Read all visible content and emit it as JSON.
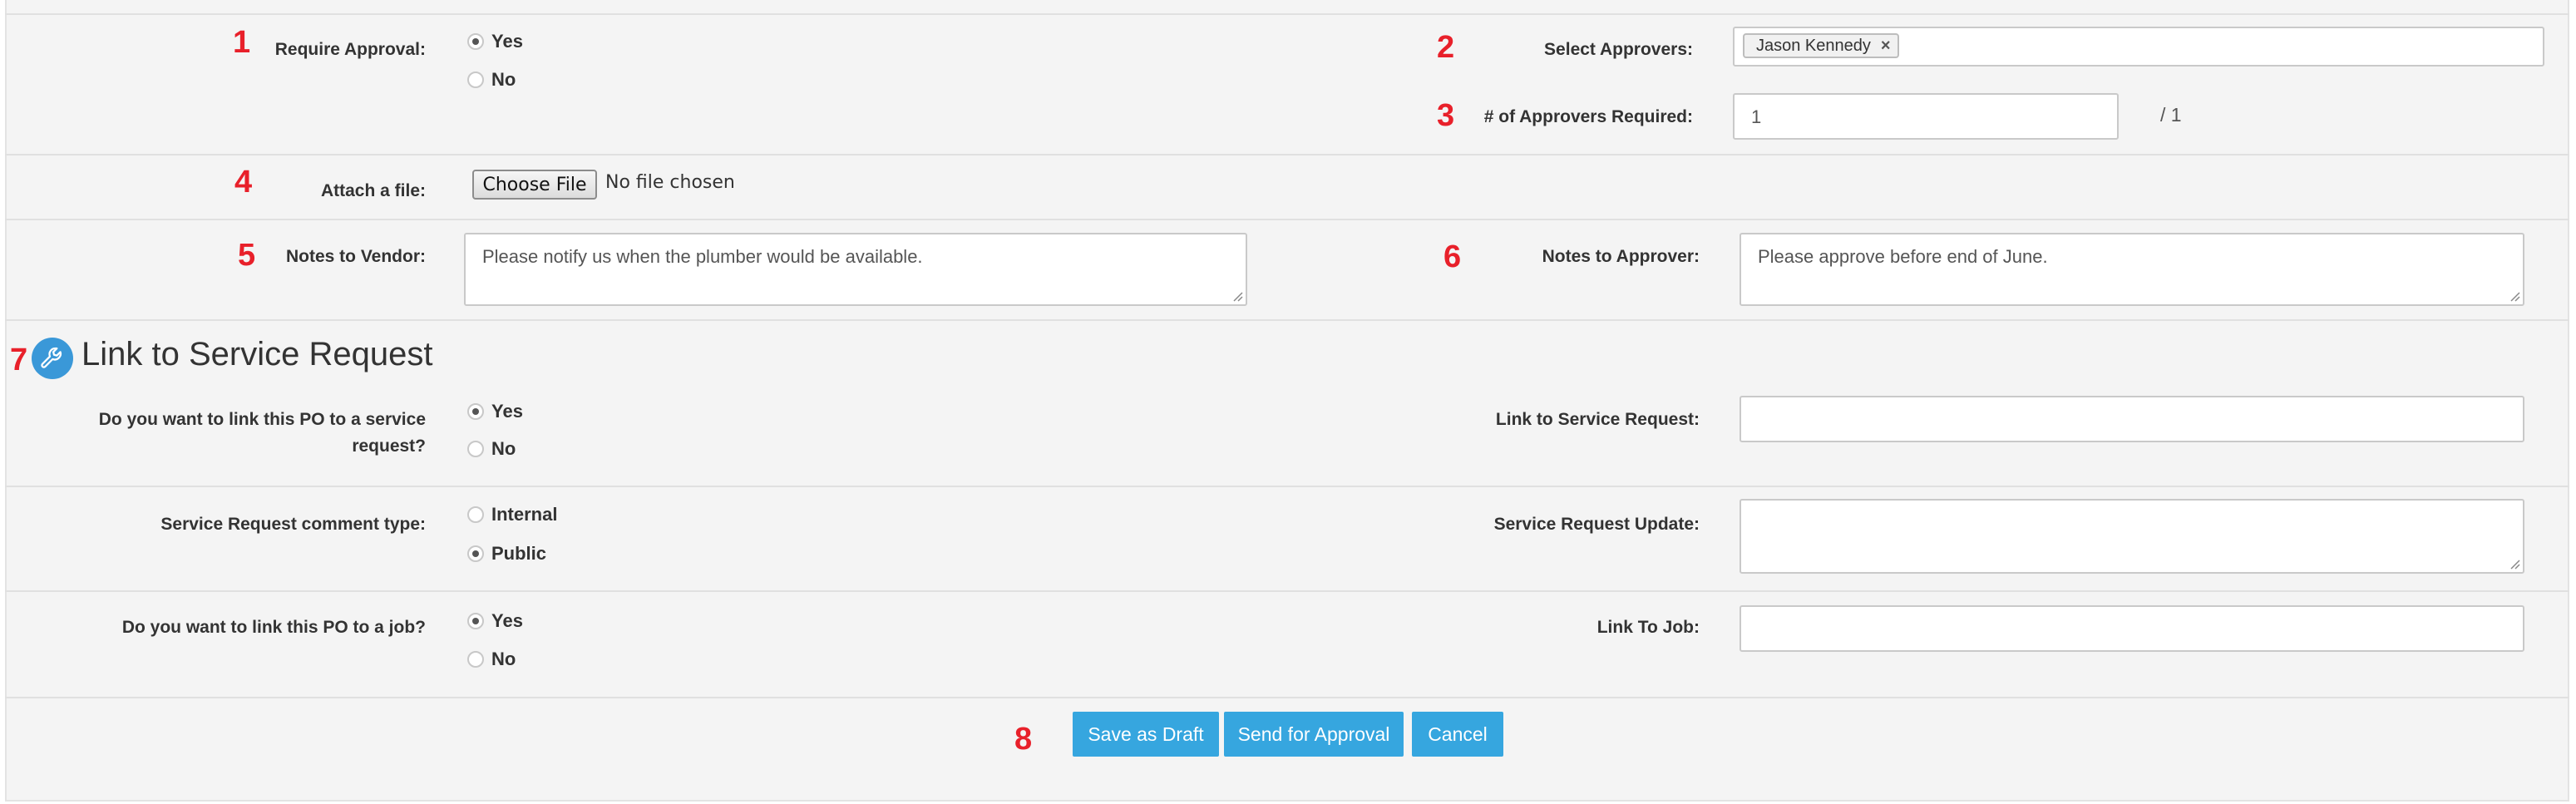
{
  "markers": [
    "1",
    "2",
    "3",
    "4",
    "5",
    "6",
    "7",
    "8"
  ],
  "approval": {
    "require_label": "Require Approval:",
    "yes": "Yes",
    "no": "No",
    "select_label": "Select Approvers:",
    "approver_tag": "Jason Kennedy",
    "remove_icon": "×",
    "required_label": "# of Approvers Required:",
    "required_value": "1",
    "required_suffix": "/ 1"
  },
  "attach": {
    "label": "Attach a file:",
    "button": "Choose File",
    "status": "No file chosen"
  },
  "notes": {
    "vendor_label": "Notes to Vendor:",
    "vendor_value": "Please notify us when the plumber would be available.",
    "approver_label": "Notes to Approver:",
    "approver_value": "Please approve before end of June."
  },
  "service": {
    "section_title": "Link to Service Request",
    "section_icon": "wrench-icon",
    "link_question_line1": "Do you want to link this PO to a service",
    "link_question_line2": "request?",
    "yes": "Yes",
    "no": "No",
    "link_label": "Link to Service Request:",
    "link_value": "",
    "comment_type_label": "Service Request comment type:",
    "internal": "Internal",
    "public": "Public",
    "update_label": "Service Request Update:",
    "update_value": "",
    "job_question": "Do you want to link this PO to a job?",
    "job_label": "Link To Job:",
    "job_value": ""
  },
  "actions": {
    "save_draft": "Save as Draft",
    "send": "Send for Approval",
    "cancel": "Cancel"
  },
  "colors": {
    "accent": "#36a6df",
    "marker": "#e8202a",
    "panel": "#f4f4f4"
  }
}
